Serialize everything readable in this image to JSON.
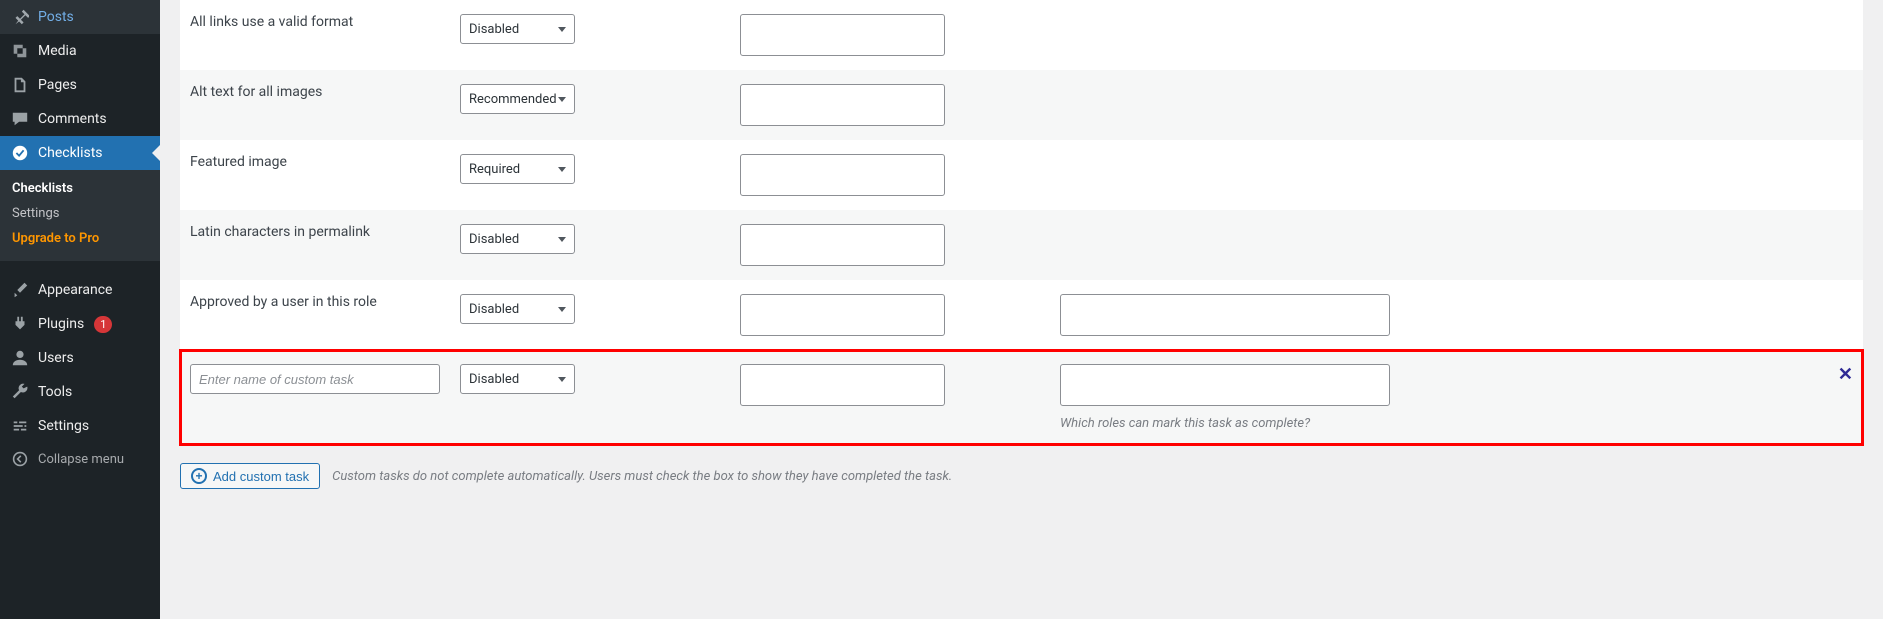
{
  "sidebar": {
    "posts": "Posts",
    "media": "Media",
    "pages": "Pages",
    "comments": "Comments",
    "checklists": "Checklists",
    "sub": {
      "checklists": "Checklists",
      "settings": "Settings",
      "upgrade": "Upgrade to Pro"
    },
    "appearance": "Appearance",
    "plugins": "Plugins",
    "plugins_badge": "1",
    "users": "Users",
    "tools": "Tools",
    "settings": "Settings",
    "collapse": "Collapse menu"
  },
  "rows": {
    "r0": {
      "label": "All links use a valid format",
      "select": "Disabled"
    },
    "r1": {
      "label": "Alt text for all images",
      "select": "Recommended"
    },
    "r2": {
      "label": "Featured image",
      "select": "Required"
    },
    "r3": {
      "label": "Latin characters in permalink",
      "select": "Disabled"
    },
    "r4": {
      "label": "Approved by a user in this role",
      "select": "Disabled"
    },
    "r5": {
      "placeholder": "Enter name of custom task",
      "select": "Disabled",
      "hint": "Which roles can mark this task as complete?"
    }
  },
  "footer": {
    "add_label": "Add custom task",
    "note": "Custom tasks do not complete automatically. Users must check the box to show they have completed the task."
  }
}
